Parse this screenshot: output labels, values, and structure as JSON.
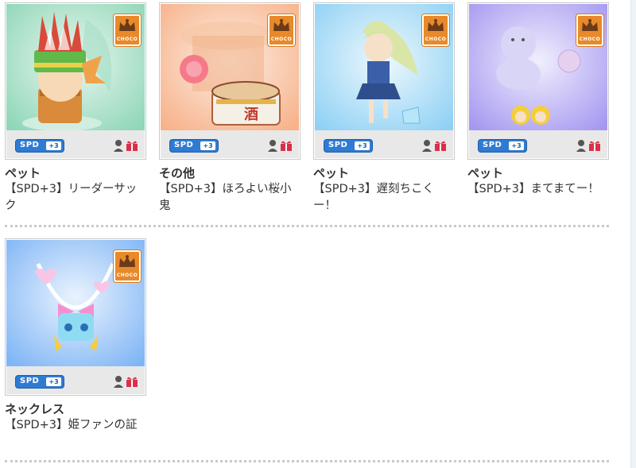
{
  "items": [
    {
      "category": "ペット",
      "name": "【SPD+3】リーダーサック",
      "badge": "CHOCO",
      "speed_label": "SPD",
      "speed_bonus": "+3",
      "bg": [
        "#8fd6b8",
        "#e9f7ef"
      ],
      "icon": "pet-leader-sack-icon"
    },
    {
      "category": "その他",
      "name": "【SPD+3】ほろよい桜小鬼",
      "badge": "CHOCO",
      "speed_label": "SPD",
      "speed_bonus": "+3",
      "bg": [
        "#f7b28a",
        "#fdeee4"
      ],
      "icon": "drum-oni-icon"
    },
    {
      "category": "ペット",
      "name": "【SPD+3】遅刻ちこくー！",
      "badge": "CHOCO",
      "speed_label": "SPD",
      "speed_bonus": "+3",
      "bg": [
        "#8fd1f4",
        "#eef8fd"
      ],
      "icon": "late-schoolgirl-icon"
    },
    {
      "category": "ペット",
      "name": "【SPD+3】まてまてー！",
      "badge": "CHOCO",
      "speed_label": "SPD",
      "speed_bonus": "+3",
      "bg": [
        "#a598f0",
        "#f1effd"
      ],
      "icon": "chasing-kids-icon"
    },
    {
      "category": "ネックレス",
      "name": "【SPD+3】姫ファンの証",
      "badge": "CHOCO",
      "speed_label": "SPD",
      "speed_bonus": "+3",
      "bg": [
        "#7fb5f5",
        "#eaf3fe"
      ],
      "icon": "princess-fan-necklace-icon"
    }
  ]
}
